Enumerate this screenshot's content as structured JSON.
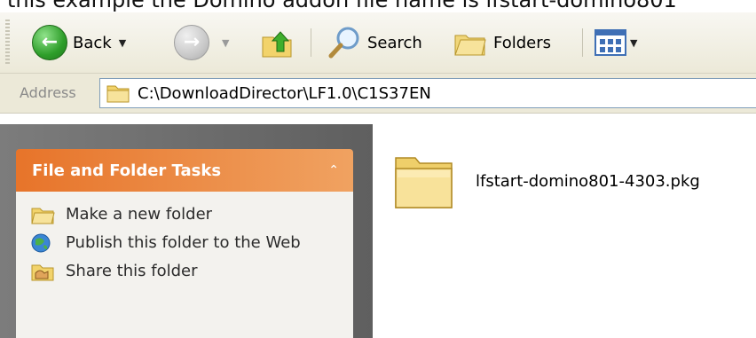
{
  "caption": "this example the Domino addon file name is lfstart-domino801",
  "toolbar": {
    "back_label": "Back",
    "search_label": "Search",
    "folders_label": "Folders"
  },
  "address": {
    "label": "Address",
    "path": "C:\\DownloadDirector\\LF1.0\\C1S37EN"
  },
  "task_panel": {
    "title": "File and Folder Tasks",
    "items": [
      {
        "label": "Make a new folder",
        "icon": "new-folder-icon"
      },
      {
        "label": "Publish this folder to the Web",
        "icon": "publish-web-icon"
      },
      {
        "label": "Share this folder",
        "icon": "share-folder-icon"
      }
    ]
  },
  "files": [
    {
      "name": "lfstart-domino801-4303.pkg",
      "icon": "folder-icon"
    }
  ],
  "colors": {
    "panel_header": "#e7742a",
    "toolbar_bg": "#ece9d8",
    "taskpane_bg": "#6d6d6d"
  }
}
